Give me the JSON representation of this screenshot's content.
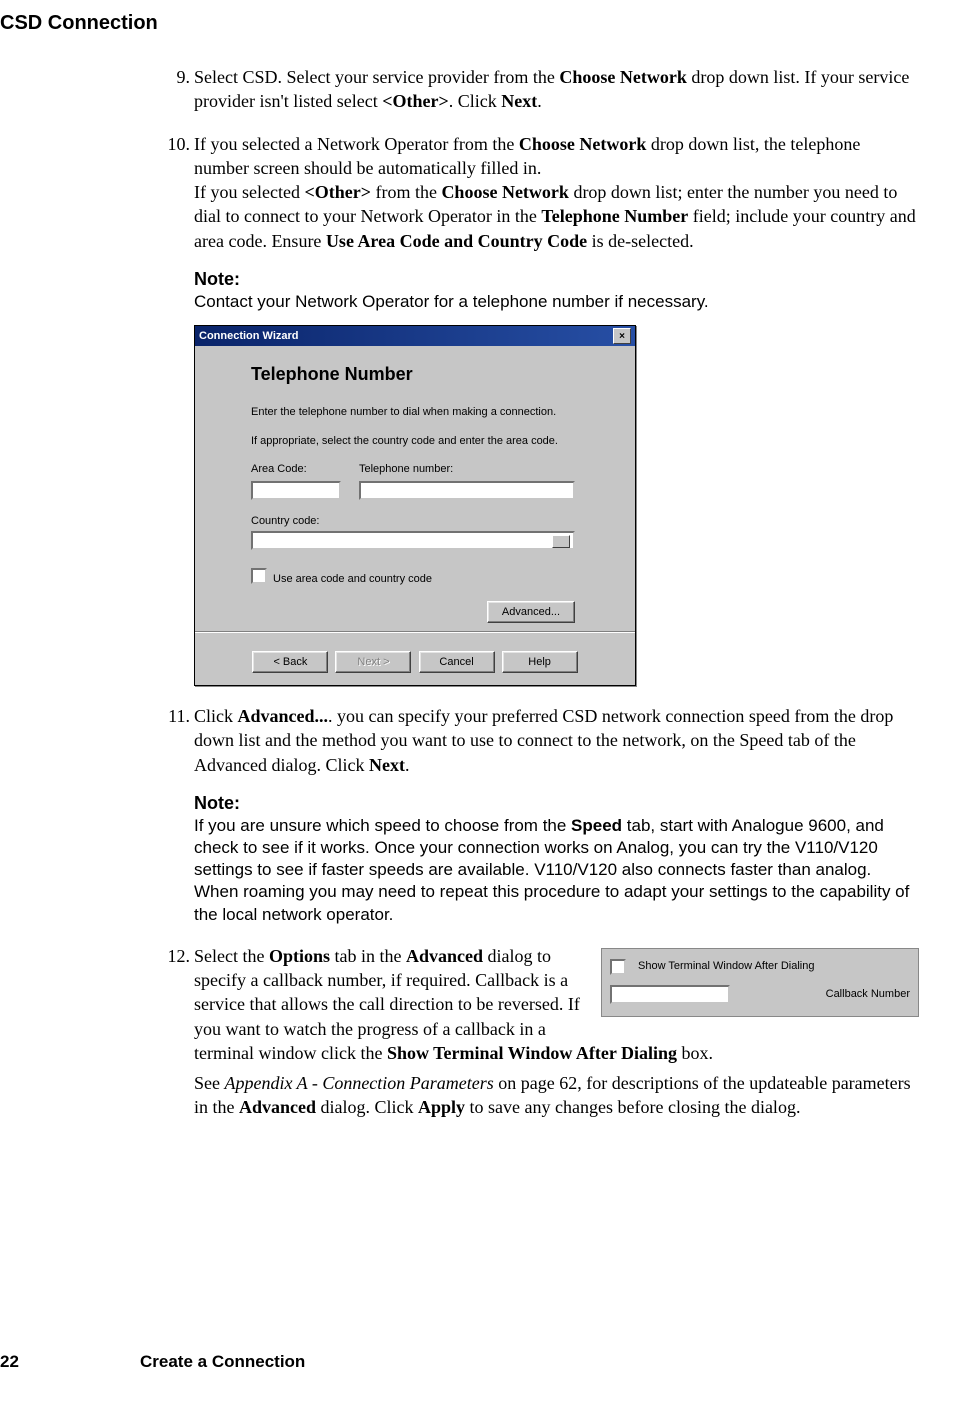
{
  "section_title": "CSD Connection",
  "steps": {
    "s9": {
      "marker": "9.",
      "p1a": "Select CSD. Select your service provider from the ",
      "p1b": "Choose Network",
      "p1c": " drop down list. If your service provider isn't listed select ",
      "p1d": "<Other>",
      "p1e": ". Click ",
      "p1f": "Next",
      "p1g": "."
    },
    "s10": {
      "marker": "10.",
      "p1a": "If you selected a Network Operator from the ",
      "p1b": "Choose Network",
      "p1c": " drop down list, the telephone number screen should be automatically filled in.",
      "p2a": "If you selected ",
      "p2b": "<Other>",
      "p2c": " from the ",
      "p2d": "Choose Network",
      "p2e": " drop down list; enter the number you need to dial to connect to your Network Operator in the ",
      "p2f": "Telephone Number",
      "p2g": " field; include your country and area code. Ensure ",
      "p2h": "Use Area Code and Country Code",
      "p2i": " is de-selected.",
      "note_label": "Note:",
      "note_body": "Contact your Network Operator for a telephone number if necessary."
    },
    "s11": {
      "marker": "11.",
      "p1a": "Click ",
      "p1b": "Advanced...",
      "p1c": ". you can specify your preferred CSD network connection speed from the drop down list and the method you want to use to connect to the network, on the Speed tab of the Advanced dialog. Click ",
      "p1d": "Next",
      "p1e": ".",
      "note_label": "Note:",
      "note_a": "If you are unsure which speed to choose from the ",
      "note_b": "Speed",
      "note_c": " tab, start with Analogue 9600, and check to see if it works. Once your connection works on Analog, you can try the V110/V120 settings to see if faster speeds are available. V110/V120 also connects faster than analog. When roaming you may need to repeat this procedure to adapt your settings to the capability of the local network operator."
    },
    "s12": {
      "marker": "12.",
      "p1a": "Select the ",
      "p1b": "Options",
      "p1c": " tab in the ",
      "p1d": "Advanced",
      "p1e": " dialog to specify a callback number, if required. Callback is a service that allows the call direction to be reversed. If you want to watch the progress of a callback in a terminal window click the ",
      "p1f": "Show Terminal Window After Dialing",
      "p1g": " box.",
      "p2a": "See ",
      "p2b": "Appendix A - Connection Parameters",
      "p2c": " on page 62, for descriptions of the updateable parameters in the ",
      "p2d": "Advanced",
      "p2e": " dialog. Click ",
      "p2f": "Apply",
      "p2g": " to save any changes before closing the dialog."
    }
  },
  "wizard": {
    "title": "Connection Wizard",
    "close": "×",
    "heading": "Telephone Number",
    "instr1": "Enter the telephone number to dial when making a connection.",
    "instr2": "If appropriate, select the country code and enter the area code.",
    "area_code_label": "Area Code:",
    "telephone_label": "Telephone number:",
    "country_code_label": "Country code:",
    "use_area_code_label": "Use area code and country code",
    "advanced_btn": "Advanced...",
    "back_btn": "< Back",
    "next_btn": "Next >",
    "cancel_btn": "Cancel",
    "help_btn": "Help"
  },
  "options_fragment": {
    "show_terminal": "Show Terminal Window After Dialing",
    "callback_number": "Callback Number"
  },
  "footer": {
    "page_number": "22",
    "chapter": "Create a Connection"
  }
}
